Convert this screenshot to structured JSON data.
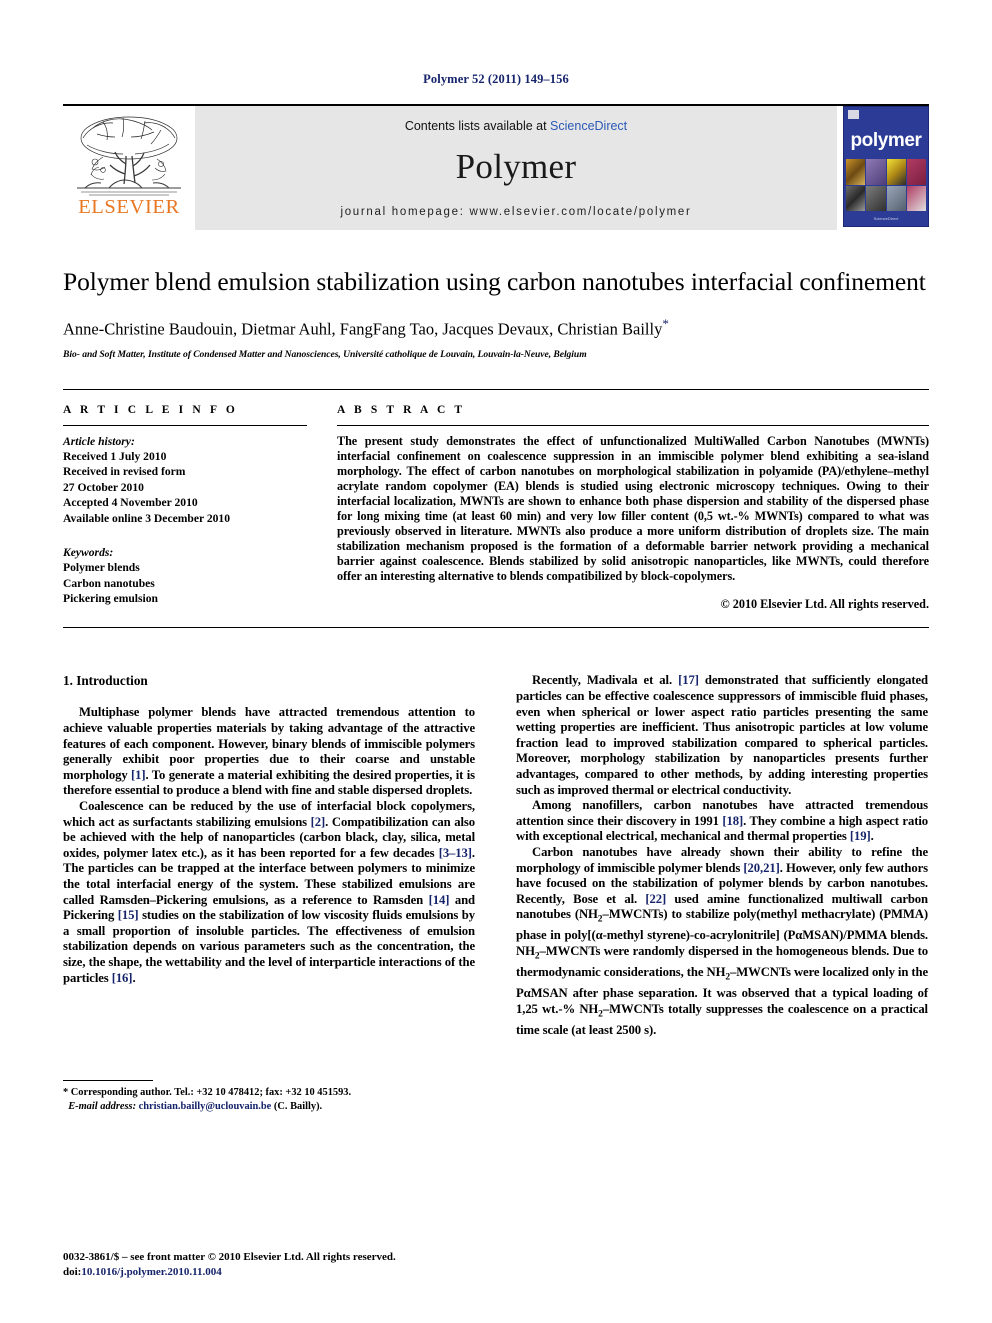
{
  "running_head": "Polymer 52 (2011) 149–156",
  "masthead": {
    "publisher_name": "ELSEVIER",
    "contents_prefix": "Contents lists available at ",
    "contents_link": "ScienceDirect",
    "journal_title": "Polymer",
    "homepage": "journal homepage: www.elsevier.com/locate/polymer",
    "cover_word": "polymer",
    "cover_footer": "ScienceDirect",
    "colors": {
      "elsevier_orange": "#e87722",
      "link_blue": "#2b59b5",
      "cover_blue": "#2c3b96",
      "running_head_navy": "#16246b"
    }
  },
  "article": {
    "title": "Polymer blend emulsion stabilization using carbon nanotubes interfacial confinement",
    "authors": "Anne-Christine Baudouin, Dietmar Auhl, FangFang Tao, Jacques Devaux, Christian Bailly",
    "corresponding_marker": "*",
    "affiliation": "Bio- and Soft Matter, Institute of Condensed Matter and Nanosciences, Université catholique de Louvain, Louvain-la-Neuve, Belgium"
  },
  "article_info": {
    "heading": "A R T I C L E   I N F O",
    "history_label": "Article history:",
    "history": [
      "Received 1 July 2010",
      "Received in revised form",
      "27 October 2010",
      "Accepted 4 November 2010",
      "Available online 3 December 2010"
    ],
    "keywords_label": "Keywords:",
    "keywords": [
      "Polymer blends",
      "Carbon nanotubes",
      "Pickering emulsion"
    ]
  },
  "abstract": {
    "heading": "A B S T R A C T",
    "text": "The present study demonstrates the effect of unfunctionalized MultiWalled Carbon Nanotubes (MWNTs) interfacial confinement on coalescence suppression in an immiscible polymer blend exhibiting a sea-island morphology. The effect of carbon nanotubes on morphological stabilization in polyamide (PA)/ethylene–methyl acrylate random copolymer (EA) blends is studied using electronic microscopy techniques. Owing to their interfacial localization, MWNTs are shown to enhance both phase dispersion and stability of the dispersed phase for long mixing time (at least 60 min) and very low filler content (0,5 wt.-% MWNTs) compared to what was previously observed in literature. MWNTs also produce a more uniform distribution of droplets size. The main stabilization mechanism proposed is the formation of a deformable barrier network providing a mechanical barrier against coalescence. Blends stabilized by solid anisotropic nanoparticles, like MWNTs, could therefore offer an interesting alternative to blends compatibilized by block-copolymers.",
    "copyright": "© 2010 Elsevier Ltd. All rights reserved."
  },
  "body": {
    "section_number_title": "1. Introduction",
    "left_paragraphs": [
      "Multiphase polymer blends have attracted tremendous attention to achieve valuable properties materials by taking advantage of the attractive features of each component. However, binary blends of immiscible polymers generally exhibit poor properties due to their coarse and unstable morphology [1]. To generate a material exhibiting the desired properties, it is therefore essential to produce a blend with fine and stable dispersed droplets.",
      "Coalescence can be reduced by the use of interfacial block copolymers, which act as surfactants stabilizing emulsions [2]. Compatibilization can also be achieved with the help of nanoparticles (carbon black, clay, silica, metal oxides, polymer latex etc.), as it has been reported for a few decades [3–13]. The particles can be trapped at the interface between polymers to minimize the total interfacial energy of the system. These stabilized emulsions are called Ramsden–Pickering emulsions, as a reference to Ramsden [14] and Pickering [15] studies on the stabilization of low viscosity fluids emulsions by a small proportion of insoluble particles. The effectiveness of emulsion stabilization depends on various parameters such as the concentration, the size, the shape, the wettability and the level of interparticle interactions of the particles [16]."
    ],
    "right_paragraphs": [
      "Recently, Madivala et al. [17] demonstrated that sufficiently elongated particles can be effective coalescence suppressors of immiscible fluid phases, even when spherical or lower aspect ratio particles presenting the same wetting properties are inefficient. Thus anisotropic particles at low volume fraction lead to improved stabilization compared to spherical particles. Moreover, morphology stabilization by nanoparticles presents further advantages, compared to other methods, by adding interesting properties such as improved thermal or electrical conductivity.",
      "Among nanofillers, carbon nanotubes have attracted tremendous attention since their discovery in 1991 [18]. They combine a high aspect ratio with exceptional electrical, mechanical and thermal properties [19].",
      "Carbon nanotubes have already shown their ability to refine the morphology of immiscible polymer blends [20,21]. However, only few authors have focused on the stabilization of polymer blends by carbon nanotubes. Recently, Bose et al. [22] used amine functionalized multiwall carbon nanotubes (NH2–MWCNTs) to stabilize poly(methyl methacrylate) (PMMA) phase in poly[(α-methyl styrene)-co-acrylonitrile] (PαMSAN)/PMMA blends. NH2–MWCNTs were randomly dispersed in the homogeneous blends. Due to thermodynamic considerations, the NH2–MWCNTs were localized only in the PαMSAN after phase separation. It was observed that a typical loading of 1,25 wt.-% NH2–MWCNTs totally suppresses the coalescence on a practical time scale (at least 2500 s)."
    ]
  },
  "footnote": {
    "corresponding": "* Corresponding author. Tel.: +32 10 478412; fax: +32 10 451593.",
    "email_label": "E-mail address:",
    "email": "christian.bailly@uclouvain.be",
    "email_suffix": "(C. Bailly)."
  },
  "imprint": {
    "line1": "0032-3861/$ – see front matter © 2010 Elsevier Ltd. All rights reserved.",
    "doi_label": "doi:",
    "doi": "10.1016/j.polymer.2010.11.004"
  }
}
